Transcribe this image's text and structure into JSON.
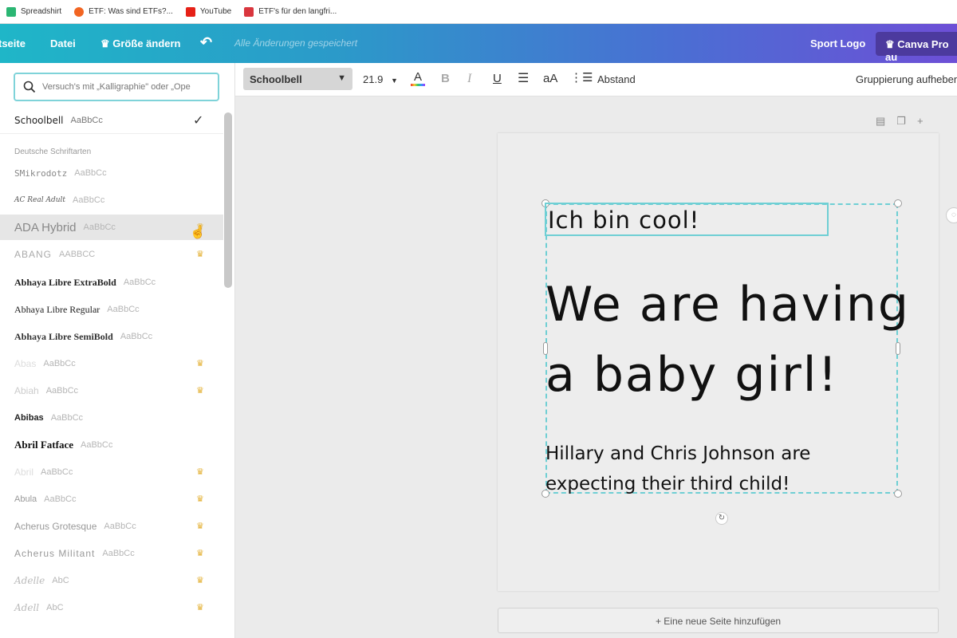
{
  "bookmarks": [
    {
      "label": "Spreadshirt",
      "color": "#2bb673"
    },
    {
      "label": "ETF: Was sind ETFs?...",
      "color": "#f26522"
    },
    {
      "label": "YouTube",
      "color": "#e62117"
    },
    {
      "label": "ETF's für den langfri...",
      "color": "#d9363e"
    }
  ],
  "topbar": {
    "home_label": "tseite",
    "file_label": "Datei",
    "resize_label": "♛ Größe ändern",
    "undo_icon": "undo-icon",
    "saved_status": "Alle Änderungen gespeichert",
    "project_title": "Sport Logo",
    "pro_label": "♛ Canva Pro au"
  },
  "font_panel": {
    "search_placeholder": "Versuch's mit „Kalligraphie\" oder „Ope",
    "selected_font": {
      "name": "Schoolbell",
      "sample": "AaBbCc"
    },
    "section_label": "Deutsche Schriftarten",
    "fonts": [
      {
        "name": "SMikrodotz",
        "sample": "AaBbCc",
        "pro": false
      },
      {
        "name": "AC Real Adult",
        "sample": "AaBbCc",
        "pro": false
      },
      {
        "name": "ADA Hybrid",
        "sample": "AaBbCc",
        "pro": true
      },
      {
        "name": "ABANG",
        "sample": "AABBCC",
        "pro": true
      },
      {
        "name": "Abhaya Libre ExtraBold",
        "sample": "AaBbCc",
        "pro": false
      },
      {
        "name": "Abhaya Libre Regular",
        "sample": "AaBbCc",
        "pro": false
      },
      {
        "name": "Abhaya Libre SemiBold",
        "sample": "AaBbCc",
        "pro": false
      },
      {
        "name": "Abas",
        "sample": "AaBbCc",
        "pro": true
      },
      {
        "name": "Abiah",
        "sample": "AaBbCc",
        "pro": true
      },
      {
        "name": "Abibas",
        "sample": "AaBbCc",
        "pro": false
      },
      {
        "name": "Abril Fatface",
        "sample": "AaBbCc",
        "pro": false
      },
      {
        "name": "Abril",
        "sample": "AaBbCc",
        "pro": true
      },
      {
        "name": "Abula",
        "sample": "AaBbCc",
        "pro": true
      },
      {
        "name": "Acherus Grotesque",
        "sample": "AaBbCc",
        "pro": true
      },
      {
        "name": "Acherus Militant",
        "sample": "AaBbCc",
        "pro": true
      },
      {
        "name": "Adelle",
        "sample": "AbC",
        "pro": true
      },
      {
        "name": "Adell",
        "sample": "AbC",
        "pro": true
      }
    ]
  },
  "format_bar": {
    "font_name": "Schoolbell",
    "font_size": "21.9",
    "color_letter": "A",
    "bold": "B",
    "italic": "I",
    "underline": "U",
    "case": "aA",
    "spacing_label": "Abstand",
    "ungroup_label": "Gruppierung aufheben"
  },
  "canvas": {
    "line1": "Ich bin cool!",
    "headline_line1": "We are having",
    "headline_line2": "a baby girl!",
    "sub_line1": "Hillary and Chris Johnson are",
    "sub_line2": "expecting their third child!",
    "add_page_label": "+ Eine neue Seite hinzufügen"
  }
}
